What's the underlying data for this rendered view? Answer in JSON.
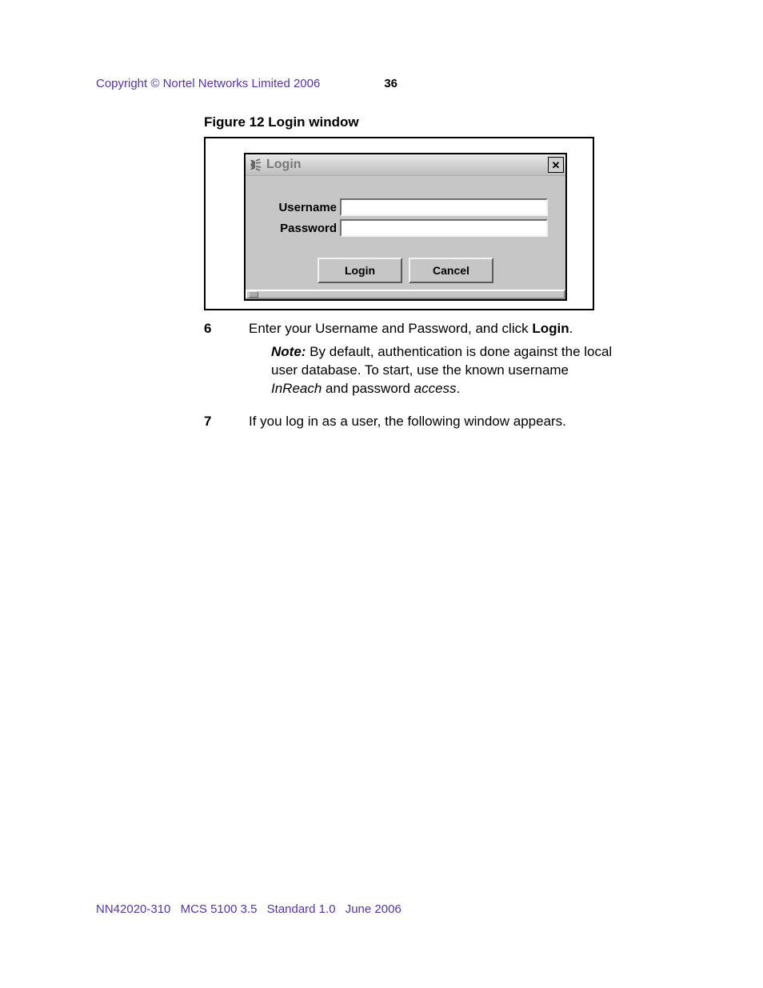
{
  "header": {
    "copyright": "Copyright © Nortel Networks Limited 2006",
    "page_number": "36"
  },
  "figure": {
    "caption": "Figure 12  Login window",
    "window": {
      "title": "Login",
      "labels": {
        "username": "Username",
        "password": "Password"
      },
      "inputs": {
        "username_value": "",
        "password_value": ""
      },
      "buttons": {
        "login": "Login",
        "cancel": "Cancel"
      }
    }
  },
  "steps": {
    "s6": {
      "num": "6",
      "text_pre": "Enter your Username and Password, and click ",
      "text_bold": "Login",
      "text_post": "."
    },
    "note": {
      "label": "Note:",
      "text1": "  By default, authentication is done against the local user database. To start, use the known username ",
      "username": "InReach",
      "text2": " and password ",
      "password": "access",
      "text3": "."
    },
    "s7": {
      "num": "7",
      "text": "If you log in as a user, the following window appears."
    }
  },
  "footer": {
    "doc_id": "NN42020-310",
    "product": "MCS 5100 3.5",
    "status": "Standard  1.0",
    "date": "June 2006"
  }
}
